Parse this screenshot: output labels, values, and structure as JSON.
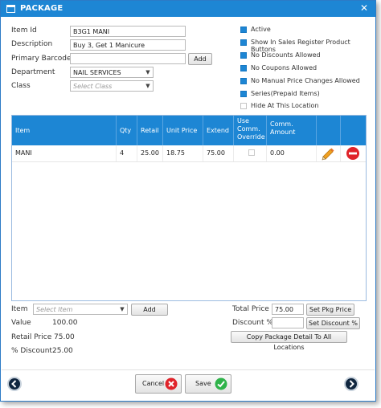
{
  "window": {
    "title": "PACKAGE",
    "close_glyph": "✕"
  },
  "form": {
    "item_id_label": "Item Id",
    "item_id_value": "B3G1 MANI",
    "description_label": "Description",
    "description_value": "Buy 3, Get 1 Manicure",
    "barcode_label": "Primary Barcode",
    "barcode_value": "",
    "add_label": "Add",
    "department_label": "Department",
    "department_value": "NAIL SERVICES",
    "class_label": "Class",
    "class_placeholder": "Select Class"
  },
  "options": [
    {
      "label": "Active",
      "checked": true
    },
    {
      "label": "Show In Sales Register Product Buttons",
      "checked": true
    },
    {
      "label": "No Discounts Allowed",
      "checked": true
    },
    {
      "label": "No Coupons Allowed",
      "checked": true
    },
    {
      "label": "No Manual Price Changes Allowed",
      "checked": true
    },
    {
      "label": "Series(Prepaid Items)",
      "checked": true
    },
    {
      "label": "Hide At This Location",
      "checked": false
    }
  ],
  "grid": {
    "headers": {
      "item": "Item",
      "qty": "Qty",
      "retail": "Retail",
      "unit_price": "Unit Price",
      "extend": "Extend",
      "use_comm_1": "Use",
      "use_comm_2": "Comm.",
      "use_comm_3": "Override",
      "comm_amount_1": "Comm.",
      "comm_amount_2": "Amount"
    },
    "rows": [
      {
        "item": "MANI",
        "qty": "4",
        "retail": "25.00",
        "unit_price": "18.75",
        "extend": "75.00",
        "use_comm_override": false,
        "comm_amount": "0.00",
        "edit_icon": "pencil-icon",
        "delete_icon": "remove-icon"
      }
    ]
  },
  "bottom": {
    "item_label": "Item",
    "item_placeholder": "Select Item",
    "add_label": "Add",
    "value_label": "Value",
    "value_value": "100.00",
    "retail_price_label": "Retail Price",
    "retail_price_value": "75.00",
    "pct_discount_label": "% Discount",
    "pct_discount_value": "25.00",
    "total_price_label": "Total Price",
    "total_price_value": "75.00",
    "set_pkg_price_label": "Set Pkg Price",
    "discount_pct_label": "Discount %",
    "discount_pct_value": "",
    "set_discount_label": "Set Discount %",
    "copy_label": "Copy Package Detail To All Locations"
  },
  "footer": {
    "cancel_label": "Cancel",
    "save_label": "Save"
  },
  "colors": {
    "accent": "#1d86d4",
    "cancel_red": "#e0232a",
    "save_green": "#2fb34a",
    "edit_orange": "#f0a020"
  }
}
